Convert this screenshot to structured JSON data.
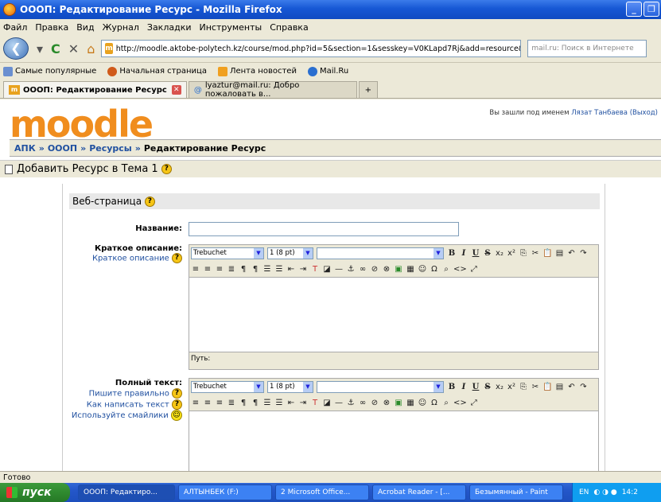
{
  "window": {
    "title": "ОООП: Редактирование Ресурс - Mozilla Firefox",
    "minimize": "_",
    "restore": "❐"
  },
  "menu": [
    "Файл",
    "Правка",
    "Вид",
    "Журнал",
    "Закладки",
    "Инструменты",
    "Справка"
  ],
  "nav": {
    "url": "http://moodle.aktobe-polytech.kz/course/mod.php?id=5&section=1&sesskey=V0KLapd7Rj&add=resource&type",
    "url_favicon": "m",
    "search_placeholder": "mail.ru: Поиск в Интернете"
  },
  "bookmarks": [
    "Самые популярные",
    "Начальная страница",
    "Лента новостей",
    "Mail.Ru"
  ],
  "tabs": [
    {
      "label": "ОООП: Редактирование Ресурс",
      "favicon": "m"
    },
    {
      "label": "lyaztur@mail.ru: Добро пожаловать в..."
    }
  ],
  "page": {
    "logo": "moodle",
    "user_prefix": "Вы зашли под именем",
    "user_name": "Лязат Танбаева",
    "logout": "(Выход)",
    "breadcrumb": [
      "АПК",
      "ОООП",
      "Ресурсы",
      "Редактирование Ресурс"
    ],
    "heading": "Добавить Ресурс в Тема 1",
    "section_title": "Веб-страница",
    "name_label": "Название:",
    "summary_label": "Краткое описание:",
    "summary_help": "Краткое описание",
    "fulltext_label": "Полный текст:",
    "help_links": [
      "Пишите правильно",
      "Как написать текст",
      "Используйте смайлики"
    ],
    "editor": {
      "font": "Trebuchet",
      "size": "1 (8 pt)",
      "path_label": "Путь:"
    }
  },
  "status": "Готово",
  "taskbar": {
    "start": "пуск",
    "tasks": [
      "ОООП: Редактиро...",
      "АЛТЫНБЕК (F:)",
      "2 Microsoft Office...",
      "Acrobat Reader - [...",
      "Безымянный - Paint"
    ],
    "lang": "EN",
    "time": "14:2"
  }
}
